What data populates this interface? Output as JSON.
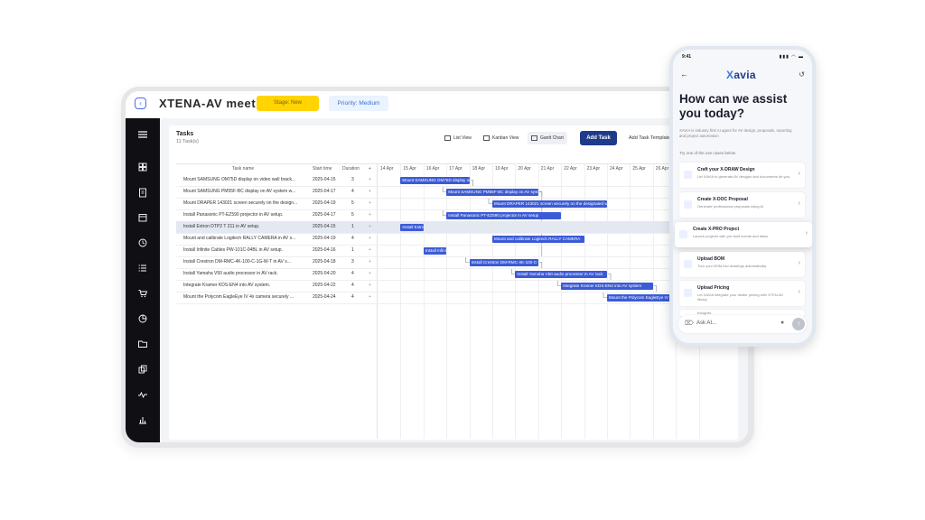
{
  "header": {
    "title": "XTENA-AV meet...",
    "stage_label": "Stage: New",
    "priority_label": "Priority: Medium"
  },
  "sidebar": {
    "icons": [
      "menu-icon",
      "dashboard-icon",
      "clipboard-icon",
      "calendar-icon",
      "clock-icon",
      "list-icon",
      "cart-icon",
      "chart-pie-icon",
      "folder-icon",
      "copy-icon",
      "activity-icon",
      "bar-chart-icon"
    ]
  },
  "tasks": {
    "title": "Tasks",
    "count": "11 Task(s)",
    "views": {
      "list": "List View",
      "kanban": "Kanban View",
      "gantt": "Gantt Chart"
    },
    "add_task": "Add Task",
    "add_template": "Add Task Template",
    "columns": {
      "name": "Task name",
      "start": "Start time",
      "duration": "Duration",
      "add": "+"
    },
    "dates": [
      "14 Apr",
      "15 Apr",
      "16 Apr",
      "17 Apr",
      "18 Apr",
      "19 Apr",
      "20 Apr",
      "21 Apr",
      "22 Apr",
      "23 Apr",
      "24 Apr",
      "25 Apr",
      "26 Apr",
      "27 Apr"
    ],
    "rows": [
      {
        "name": "Mount SAMSUNG OM75D display on video wall brack...",
        "start": "2025-04-15",
        "duration": "3",
        "bar": "Mount SAMSUNG OM75D display on video wall bracket"
      },
      {
        "name": "Mount SAMSUNG PM55F-BC display on AV system w...",
        "start": "2025-04-17",
        "duration": "4",
        "bar": "Mount SAMSUNG PM55F-BC display on AV system wall"
      },
      {
        "name": "Mount DRAPER 143021 screen securely on the design...",
        "start": "2025-04-19",
        "duration": "5",
        "bar": "Mount DRAPER 143021 screen securely on the designated wall"
      },
      {
        "name": "Install Panasonic PT-EZ590 projector in AV setup.",
        "start": "2025-04-17",
        "duration": "5",
        "bar": "Install Panasonic PT-EZ590 projector in AV setup"
      },
      {
        "name": "Install Extron DTP2 T 211 in AV setup.",
        "start": "2025-04-15",
        "duration": "1",
        "bar": "Install Extron DTP2 T 211"
      },
      {
        "name": "Mount and calibrate Logitech RALLY CAMERA in AV s...",
        "start": "2025-04-19",
        "duration": "4",
        "bar": "Mount and calibrate Logitech RALLY CAMERA"
      },
      {
        "name": "Install Infinite Cables PW-101C-04BL in AV setup.",
        "start": "2025-04-16",
        "duration": "1",
        "bar": "Install Infinite Cables PW-101C-04BL"
      },
      {
        "name": "Install Crestron DM-RMC-4K-100-C-1G-W-T in AV s...",
        "start": "2025-04-18",
        "duration": "3",
        "bar": "Install Crestron DM-RMC-4K-100-C-1G-W-T in AV setup"
      },
      {
        "name": "Install Yamaha V50 audio processor in AV rack.",
        "start": "2025-04-20",
        "duration": "4",
        "bar": "Install Yamaha V50 audio processor in AV rack"
      },
      {
        "name": "Integrate Kramer KDS-EN4 into AV system.",
        "start": "2025-04-22",
        "duration": "4",
        "bar": "Integrate Kramer KDS-EN4 into AV system"
      },
      {
        "name": "Mount the Polycom EagleEye IV 4x camera securely ...",
        "start": "2025-04-24",
        "duration": "4",
        "bar": "Mount the Polycom EagleEye IV 4x camera securely"
      }
    ]
  },
  "phone": {
    "time": "9:41",
    "status_icons": "▮▮▮ ◠ ▬",
    "logo_x": "X",
    "logo_rest": "avia",
    "heading": "How can we assist you today?",
    "description": "XAVIA is industry first AI agent for AV design, proposals, reporting and project automation",
    "try_label": "Try one of the use cases below",
    "cards": [
      {
        "title": "Craft your X-DRAW Design",
        "desc": "Let XAVIA to generate AV designs and documents for you."
      },
      {
        "title": "Create X-DOC Proposal",
        "desc": "Generate professional proposals using AI"
      },
      {
        "title": "Create X-PRO Project",
        "desc": "Launch projects with pre-built events and tasks"
      },
      {
        "title": "Upload BOM",
        "desc": "Turn your BOM into drawings automatically"
      },
      {
        "title": "Upload Pricing",
        "desc": "Let XAVIA integrate your dealer pricing with XTEN-AV library"
      },
      {
        "title": "Insights",
        "desc": ""
      }
    ],
    "input_placeholder": "Ask AI..."
  },
  "colors": {
    "accent": "#1e3a8a",
    "bar": "#3b5bd6",
    "stage": "#ffd400",
    "sidebar": "#0f0f14"
  }
}
